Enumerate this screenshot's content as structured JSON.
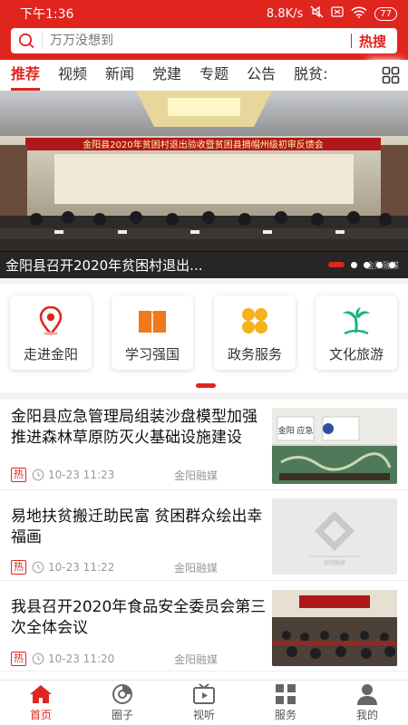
{
  "status": {
    "time": "下午1:36",
    "speed": "8.8K/s",
    "battery": "77"
  },
  "search": {
    "placeholder": "万万没想到",
    "hot_label": "热搜"
  },
  "tabs": [
    {
      "label": "推荐",
      "active": true
    },
    {
      "label": "视频"
    },
    {
      "label": "新闻"
    },
    {
      "label": "党建"
    },
    {
      "label": "专题"
    },
    {
      "label": "公告"
    },
    {
      "label": "脱贫:"
    }
  ],
  "banner": {
    "caption": "金阳县召开2020年贫困村退出...",
    "stage_banner_text": "金阳县2020年贫困村退出验收暨贫困县摘帽州级初审反馈会",
    "watermark": "金阳融媒",
    "slide_count": 5,
    "active_slide": 0
  },
  "quick_links": [
    {
      "label": "走进金阳",
      "icon": "location-pin-icon",
      "color": "#e0251f"
    },
    {
      "label": "学习强国",
      "icon": "book-icon",
      "color": "#f0781e"
    },
    {
      "label": "政务服务",
      "icon": "clover-icon",
      "color": "#f5b21b"
    },
    {
      "label": "文化旅游",
      "icon": "palm-tree-icon",
      "color": "#19b57a"
    }
  ],
  "news": [
    {
      "title": "金阳县应急管理局组装沙盘模型加强推进森林草原防灭火基础设施建设",
      "tag": "热",
      "time": "10-23 11:23",
      "source": "金阳融媒",
      "thumb": "sandbox-photo",
      "thumb_text": "金阳 应急"
    },
    {
      "title": "易地扶贫搬迁助民富 贫困群众绘出幸福画",
      "tag": "热",
      "time": "10-23 11:22",
      "source": "金阳融媒",
      "thumb": "placeholder",
      "thumb_text": "金阳融媒"
    },
    {
      "title": "我县召开2020年食品安全委员会第三次全体会议",
      "tag": "热",
      "time": "10-23 11:20",
      "source": "金阳融媒",
      "thumb": "meeting-photo"
    }
  ],
  "bottom_nav": [
    {
      "label": "首页",
      "icon": "home-icon",
      "active": true
    },
    {
      "label": "圈子",
      "icon": "circle-icon"
    },
    {
      "label": "视听",
      "icon": "tv-icon"
    },
    {
      "label": "服务",
      "icon": "services-grid-icon"
    },
    {
      "label": "我的",
      "icon": "user-icon"
    }
  ],
  "colors": {
    "brand": "#e0251f"
  }
}
